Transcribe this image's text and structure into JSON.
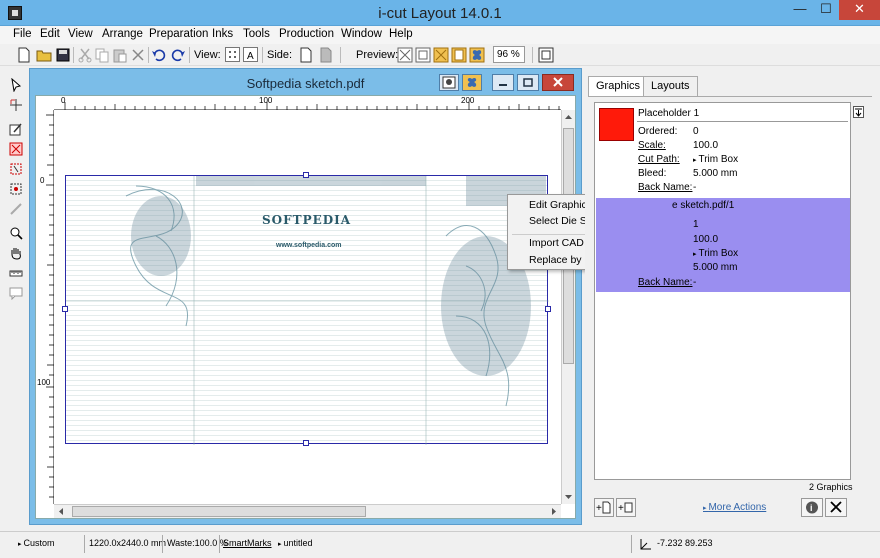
{
  "window": {
    "title": "i-cut Layout 14.0.1",
    "min": "—",
    "max": "☐",
    "close": "✕"
  },
  "menu": [
    "File",
    "Edit",
    "View",
    "Arrange",
    "Preparation",
    "Inks",
    "Tools",
    "Production",
    "Window",
    "Help"
  ],
  "toolbar": {
    "view_label": "View:",
    "side_label": "Side:",
    "preview_label": "Preview:",
    "zoom_value": "96 %"
  },
  "document": {
    "title": "Softpedia sketch.pdf",
    "ruler_top": [
      "0",
      "100",
      "200"
    ],
    "ruler_left": [
      "0",
      "100"
    ],
    "artwork": {
      "logo_text": "SOFTPEDIA",
      "url_text": "www.softpedia.com"
    }
  },
  "context_menu": [
    "Edit Graphics File...",
    "Select Die Shape...",
    "Import CAD Design...",
    "Replace by Graphics File..."
  ],
  "panel": {
    "tabs": [
      "Graphics",
      "Layouts"
    ],
    "items": [
      {
        "name": "Placeholder 1",
        "ordered_label": "Ordered:",
        "ordered": "0",
        "scale_label": "Scale:",
        "scale": "100.0",
        "cutpath_label": "Cut Path:",
        "cutpath": "Trim Box",
        "bleed_label": "Bleed:",
        "bleed": "5.000 mm",
        "backname_label": "Back Name:",
        "backname": "-",
        "swatch_color": "#ff1a0a"
      },
      {
        "name": "e sketch.pdf/1",
        "ordered": "1",
        "scale": "100.0",
        "cutpath": "Trim Box",
        "bleed": "5.000 mm",
        "backname_label": "Back Name:",
        "backname": "-",
        "highlight_color": "#9a8ef0"
      }
    ],
    "count": "2 Graphics",
    "more_actions": "More Actions"
  },
  "status": {
    "custom": "Custom",
    "sheet_size": "1220.0x2440.0 mm",
    "waste": "Waste:100.0 %",
    "smartmarks": "SmartMarks",
    "untitled": "untitled",
    "coords": "-7.232  89.253"
  }
}
